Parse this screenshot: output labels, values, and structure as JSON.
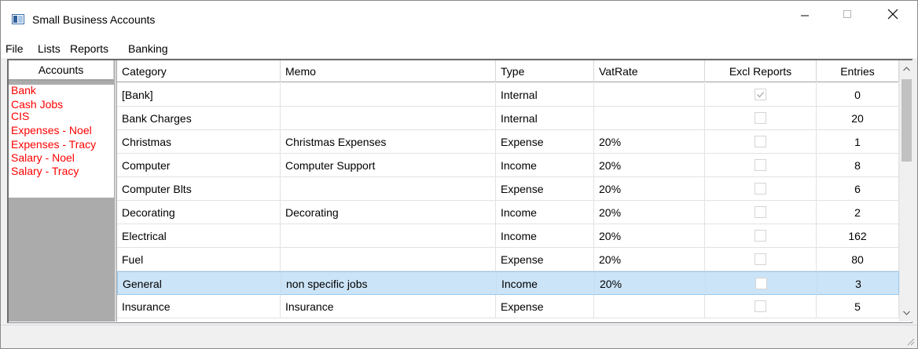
{
  "window": {
    "title": "Small Business Accounts",
    "controls": [
      "minimize",
      "maximize",
      "close"
    ]
  },
  "menu": {
    "items": [
      {
        "label": "File"
      },
      {
        "label": "Lists"
      },
      {
        "label": "Reports"
      },
      {
        "label": "Banking"
      }
    ]
  },
  "accounts": {
    "header": "Accounts",
    "text_color": "#ff0000",
    "items": [
      {
        "label": "Bank"
      },
      {
        "label": "Cash Jobs"
      },
      {
        "label": "CIS"
      },
      {
        "label": "Expenses - Noel"
      },
      {
        "label": "Expenses - Tracy"
      },
      {
        "label": "Salary - Noel"
      },
      {
        "label": "Salary - Tracy"
      }
    ]
  },
  "grid": {
    "columns": [
      {
        "label": "Category"
      },
      {
        "label": "Memo"
      },
      {
        "label": "Type"
      },
      {
        "label": "VatRate"
      },
      {
        "label": "Excl Reports"
      },
      {
        "label": "Entries"
      }
    ],
    "selected_row_color": "#cce4f7",
    "rows": [
      {
        "category": "[Bank]",
        "memo": "",
        "type": "Internal",
        "vatrate": "",
        "excl_reports": true,
        "entries": "0",
        "selected": false
      },
      {
        "category": "Bank Charges",
        "memo": "",
        "type": "Internal",
        "vatrate": "",
        "excl_reports": false,
        "entries": "20",
        "selected": false
      },
      {
        "category": "Christmas",
        "memo": "Christmas Expenses",
        "type": "Expense",
        "vatrate": "20%",
        "excl_reports": false,
        "entries": "1",
        "selected": false
      },
      {
        "category": "Computer",
        "memo": "Computer Support",
        "type": "Income",
        "vatrate": "20%",
        "excl_reports": false,
        "entries": "8",
        "selected": false
      },
      {
        "category": "Computer Blts",
        "memo": "",
        "type": "Expense",
        "vatrate": "20%",
        "excl_reports": false,
        "entries": "6",
        "selected": false
      },
      {
        "category": "Decorating",
        "memo": "Decorating",
        "type": "Income",
        "vatrate": "20%",
        "excl_reports": false,
        "entries": "2",
        "selected": false
      },
      {
        "category": "Electrical",
        "memo": "",
        "type": "Income",
        "vatrate": "20%",
        "excl_reports": false,
        "entries": "162",
        "selected": false
      },
      {
        "category": "Fuel",
        "memo": "",
        "type": "Expense",
        "vatrate": "20%",
        "excl_reports": false,
        "entries": "80",
        "selected": false
      },
      {
        "category": "General",
        "memo": "non specific jobs",
        "type": "Income",
        "vatrate": "20%",
        "excl_reports": false,
        "entries": "3",
        "selected": true
      },
      {
        "category": "Insurance",
        "memo": "Insurance",
        "type": "Expense",
        "vatrate": "",
        "excl_reports": false,
        "entries": "5",
        "selected": false
      }
    ]
  },
  "icons": {
    "app": "app-window-icon",
    "minimize": "minimize-icon",
    "maximize": "maximize-icon",
    "close": "close-icon",
    "scroll_up": "chevron-up-icon",
    "scroll_down": "chevron-down-icon",
    "checkmark": "checkmark-icon",
    "resize_grip": "resize-grip-icon"
  }
}
